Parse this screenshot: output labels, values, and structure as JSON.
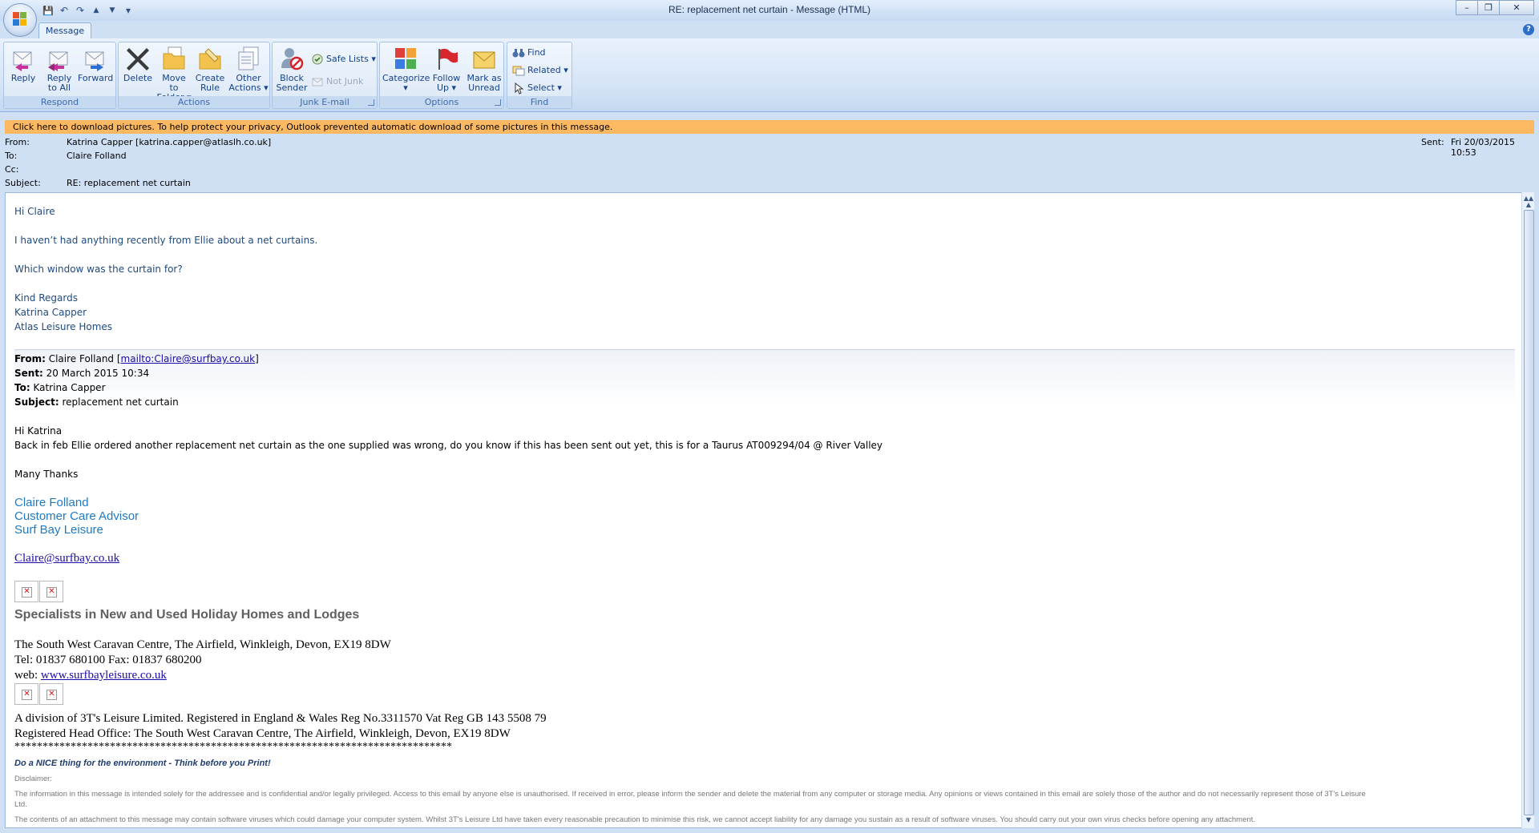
{
  "window": {
    "title": "RE: replacement net curtain - Message (HTML)",
    "minimize": "–",
    "maximize": "❐",
    "close": "✕"
  },
  "quick_access": {
    "save": "💾",
    "undo": "↶",
    "redo": "↷",
    "prev": "▲",
    "next": "▼",
    "more": "▾"
  },
  "ribbon": {
    "tab": "Message",
    "help": "?",
    "groups": {
      "respond": {
        "label": "Respond",
        "reply": "Reply",
        "reply_all_1": "Reply",
        "reply_all_2": "to All",
        "forward": "Forward"
      },
      "actions": {
        "label": "Actions",
        "delete": "Delete",
        "move_1": "Move to",
        "move_2": "Folder ▾",
        "rule_1": "Create",
        "rule_2": "Rule",
        "other_1": "Other",
        "other_2": "Actions ▾"
      },
      "junk": {
        "label": "Junk E-mail",
        "block_1": "Block",
        "block_2": "Sender",
        "safe_lists": "Safe Lists ▾",
        "not_junk": "Not Junk"
      },
      "options": {
        "label": "Options",
        "categorize": "Categorize",
        "categorize_arrow": "▾",
        "follow_1": "Follow",
        "follow_2": "Up ▾",
        "mark_1": "Mark as",
        "mark_2": "Unread"
      },
      "find": {
        "label": "Find",
        "find": "Find",
        "related": "Related ▾",
        "select": "Select ▾"
      }
    }
  },
  "infobar": "Click here to download pictures. To help protect your privacy, Outlook prevented automatic download of some pictures in this message.",
  "header": {
    "from_label": "From:",
    "from": "Katrina Capper [katrina.capper@atlaslh.co.uk]",
    "to_label": "To:",
    "to": "Claire Folland",
    "cc_label": "Cc:",
    "cc": "",
    "subject_label": "Subject:",
    "subject": "RE: replacement net curtain",
    "sent_label": "Sent:",
    "sent": "Fri 20/03/2015 10:53"
  },
  "body": {
    "greeting": "Hi Claire",
    "line1": "I haven’t had anything recently from Ellie about a net curtains.",
    "line2": "Which window was the curtain for?",
    "regards": "Kind Regards",
    "name": "Katrina Capper",
    "company": "Atlas Leisure Homes",
    "quoted": {
      "from_label": "From:",
      "from_name": " Claire Folland [",
      "from_link": "mailto:Claire@surfbay.co.uk",
      "from_close": "]",
      "sent_label": "Sent:",
      "sent": " 20 March 2015 10:34",
      "to_label": "To:",
      "to": " Katrina Capper",
      "subject_label": "Subject:",
      "subject": " replacement net curtain",
      "greeting": "Hi Katrina",
      "message": "Back in feb Ellie ordered another replacement net curtain as the one supplied was wrong, do you know if this has been sent out yet, this is for a Taurus AT009294/04 @ River Valley",
      "thanks": "Many Thanks",
      "sig_name": "Claire Folland",
      "sig_title": "Customer Care Advisor",
      "sig_company": "Surf Bay Leisure",
      "sig_email": "Claire@surfbay.co.uk",
      "specialists": "Specialists in New and Used Holiday Homes and Lodges",
      "address": "The South West Caravan Centre, The Airfield, Winkleigh, Devon, EX19 8DW",
      "tel": "Tel: 01837 680100  Fax: 01837 680200",
      "web_label": "web: ",
      "web_link": "www.surfbayleisure.co.uk",
      "division": "A division of 3T's Leisure Limited. Registered in England & Wales Reg No.3311570  Vat Reg GB 143 5508 79",
      "head_office": "Registered Head Office: The South West Caravan Centre, The Airfield, Winkleigh, Devon, EX19 8DW",
      "stars": "******************************************************************************",
      "nice": "Do a NICE thing for the environment - Think before you Print!",
      "disclaimer_label": "Disclaimer:",
      "disclaimer1": "The information in this message is intended solely for the addressee and is confidential and/or legally privileged. Access to this email by anyone else is unauthorised. If received in error, please inform the sender and delete the material from any computer or storage media. Any opinions or views contained in this email are solely those of the author and do not necessarily represent those of  3T's Leisure",
      "disclaimer1b": "Ltd.",
      "disclaimer2": "The contents of an attachment to this message may contain software viruses which could damage your computer system.  Whilst 3T's Leisure Ltd have taken every reasonable precaution to minimise this risk, we cannot accept liability for any damage you sustain as a result of software viruses.  You should carry out your own virus checks before opening any attachment."
    }
  },
  "broken_image": "✕",
  "scroll": {
    "up": "▲",
    "down": "▼",
    "top": "▲▲"
  }
}
